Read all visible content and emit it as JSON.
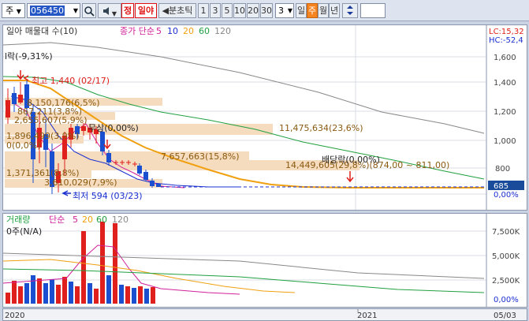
{
  "toolbar": {
    "market": "주",
    "code": "056450",
    "btn_jeong": "정",
    "btn_ilya": "일야",
    "btn_bunchotik": "◀분초틱",
    "periods": [
      "1",
      "3",
      "5",
      "10",
      "20",
      "30"
    ],
    "interval_value": "3",
    "tf_il": "일",
    "tf_ju": "주",
    "tf_wol": "월",
    "tf_nyeon": "년"
  },
  "price_panel": {
    "legend_name": "일아 매물대 수(10)",
    "legend_ma": "종가 단순",
    "ma_periods": [
      "5",
      "10",
      "20",
      "60",
      "120"
    ],
    "lc_label": "LC:15,32",
    "hc_label": "HC:-52,4",
    "y_ticks": [
      "1,600",
      "1,400",
      "1,200",
      "1,000",
      "800",
      "0,00%"
    ],
    "current_price": "685",
    "annotations": {
      "drop": "l락(-9,31%)",
      "high": "최고 1,440 (02/17)",
      "low": "최저 594 (03/23)",
      "b1": "8,150,176(6,5%)",
      "b2": "867,211(3,8%)",
      "b3": "2,655,607(5,9%)",
      "b4": "1,896,499(3,9%)",
      "b5": "0(0,0%)",
      "b6": "1,371,361(8,8%)",
      "b7": "3,610,029(7,9%)",
      "b8": "11,475,634(23,6%)",
      "b9": "7,657,663(15,8%)",
      "b10": "14,449,605(29,8%)(874,00 ~ 811,00)",
      "mid": "배당락(0,00%)",
      "mid2": "무상(0,00%)"
    }
  },
  "volume_panel": {
    "legend_name": "거래량",
    "legend_ma": "단순",
    "ma_periods": [
      "5",
      "20",
      "60",
      "120"
    ],
    "value_label": "0주(N/A)",
    "y_ticks": [
      "7,500K",
      "5,000K",
      "2,500K",
      "0,00%"
    ]
  },
  "x_axis": {
    "labels": [
      "2020",
      "2021",
      "05/03"
    ]
  },
  "colors": {
    "up": "#e0201c",
    "down": "#1a4fd0",
    "ma5": "#d0209a",
    "ma10": "#1a2fd0",
    "ma20": "#f0a010",
    "ma60": "#20a040",
    "ma120": "#888888",
    "profile": "#f6dcbe"
  }
}
